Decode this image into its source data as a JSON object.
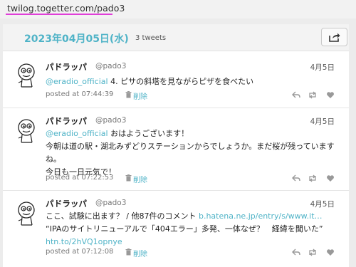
{
  "browser": {
    "url": "twilog.togetter.com/pado3"
  },
  "header": {
    "date": "2023年04月05日(水)",
    "count": "3 tweets"
  },
  "icons": {
    "share": "share-icon",
    "trash": "trash-icon",
    "reply": "reply-icon",
    "retweet": "retweet-icon",
    "like": "heart-icon"
  },
  "colors": {
    "accent": "#4fb3c7",
    "underline": "#e03fd8"
  },
  "tweets": [
    {
      "name": "パドラッパ",
      "handle": "@pado3",
      "date": "4月5日",
      "mention": "@eradio_official",
      "line1": " 4. ピサの斜塔を見ながらピザを食べたい",
      "posted": "posted at 07:44:39",
      "delete": "削除"
    },
    {
      "name": "パドラッパ",
      "handle": "@pado3",
      "date": "4月5日",
      "mention": "@eradio_official",
      "line1": " おはようございます！",
      "line2": "今朝は道の駅・湖北みずどりステーションからでしょうか。まだ桜が残っていますね。",
      "line3": "今日も一日元気で！",
      "posted": "posted at 07:22:53",
      "delete": "削除"
    },
    {
      "name": "パドラッパ",
      "handle": "@pado3",
      "date": "4月5日",
      "text1": "ここ、試験に出ます？ / 他87件のコメント ",
      "link1": "b.hatena.ne.jp/entry/s/www.it…",
      "text2": " “IPAのサイトリニューアルで「404エラー」多発、一体なぜ？　経緯を聞いた”",
      "link2": "htn.to/2hVQ1opnye",
      "posted": "posted at 07:12:08",
      "delete": "削除"
    }
  ]
}
